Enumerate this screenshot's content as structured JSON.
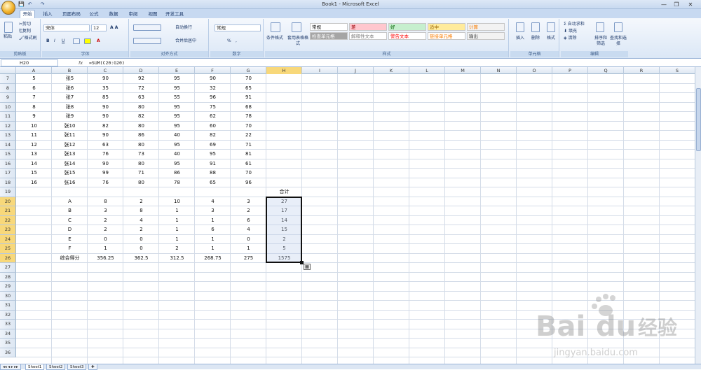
{
  "app": {
    "title": "Book1 - Microsoft Excel"
  },
  "qat": {
    "save": "💾",
    "undo": "↶",
    "redo": "↷"
  },
  "tabs": [
    "开始",
    "插入",
    "页面布局",
    "公式",
    "数据",
    "审阅",
    "视图",
    "开发工具"
  ],
  "ribbon": {
    "clipboard": {
      "label": "剪贴板",
      "paste": "粘贴",
      "cut": "剪切",
      "copy": "复制",
      "format_painter": "格式刷"
    },
    "font": {
      "label": "字体",
      "name": "宋体",
      "size": "12",
      "bold": "B",
      "italic": "I",
      "underline": "U"
    },
    "alignment": {
      "label": "对齐方式",
      "wrap": "自动换行",
      "merge": "合并后居中"
    },
    "number": {
      "label": "数字",
      "format": "常规",
      "percent": "%",
      "comma": ","
    },
    "styles": {
      "label": "样式",
      "conditional": "条件格式",
      "table": "套用表格格式",
      "cells": [
        {
          "text": "常规",
          "bg": "#ffffff",
          "fg": "#000000"
        },
        {
          "text": "差",
          "bg": "#ffc7ce",
          "fg": "#9c0006"
        },
        {
          "text": "好",
          "bg": "#c6efce",
          "fg": "#006100"
        },
        {
          "text": "适中",
          "bg": "#ffeb9c",
          "fg": "#9c6500"
        },
        {
          "text": "计算",
          "bg": "#f2f2f2",
          "fg": "#fa7d00"
        },
        {
          "text": "检查单元格",
          "bg": "#a5a5a5",
          "fg": "#ffffff"
        },
        {
          "text": "解释性文本",
          "bg": "#ffffff",
          "fg": "#7f7f7f"
        },
        {
          "text": "警告文本",
          "bg": "#ffffff",
          "fg": "#ff0000"
        },
        {
          "text": "链接单元格",
          "bg": "#ffffff",
          "fg": "#fa7d00"
        },
        {
          "text": "输出",
          "bg": "#f2f2f2",
          "fg": "#3f3f3f"
        }
      ]
    },
    "cells_group": {
      "label": "单元格",
      "insert": "插入",
      "delete": "删除",
      "format": "格式"
    },
    "editing": {
      "label": "编辑",
      "autosum": "自动求和",
      "fill": "填充",
      "clear": "清除",
      "sort": "排序和筛选",
      "find": "查找和选择"
    }
  },
  "formula_bar": {
    "name_box": "H20",
    "fx": "fx",
    "formula": "=SUM(C20:G20)"
  },
  "columns": [
    "A",
    "B",
    "C",
    "D",
    "E",
    "F",
    "G",
    "H",
    "I",
    "J",
    "K",
    "L",
    "M",
    "N",
    "O",
    "P",
    "Q",
    "R",
    "S"
  ],
  "selected_column": "H",
  "first_row": 7,
  "last_row": 36,
  "selected_rows": [
    20,
    21,
    22,
    23,
    24,
    25,
    26
  ],
  "rows": [
    {
      "r": 7,
      "cells": [
        "5",
        "张5",
        "90",
        "92",
        "95",
        "90",
        "70",
        ""
      ]
    },
    {
      "r": 8,
      "cells": [
        "6",
        "张6",
        "35",
        "72",
        "95",
        "32",
        "65",
        ""
      ]
    },
    {
      "r": 9,
      "cells": [
        "7",
        "张7",
        "85",
        "63",
        "55",
        "96",
        "91",
        ""
      ]
    },
    {
      "r": 10,
      "cells": [
        "8",
        "张8",
        "90",
        "80",
        "95",
        "75",
        "68",
        ""
      ]
    },
    {
      "r": 11,
      "cells": [
        "9",
        "张9",
        "90",
        "82",
        "95",
        "62",
        "78",
        ""
      ]
    },
    {
      "r": 12,
      "cells": [
        "10",
        "张10",
        "82",
        "80",
        "95",
        "60",
        "70",
        ""
      ]
    },
    {
      "r": 13,
      "cells": [
        "11",
        "张11",
        "90",
        "86",
        "40",
        "82",
        "22",
        ""
      ]
    },
    {
      "r": 14,
      "cells": [
        "12",
        "张12",
        "63",
        "80",
        "95",
        "69",
        "71",
        ""
      ]
    },
    {
      "r": 15,
      "cells": [
        "13",
        "张13",
        "76",
        "73",
        "40",
        "95",
        "81",
        ""
      ]
    },
    {
      "r": 16,
      "cells": [
        "14",
        "张14",
        "90",
        "80",
        "95",
        "91",
        "61",
        ""
      ]
    },
    {
      "r": 17,
      "cells": [
        "15",
        "张15",
        "99",
        "71",
        "86",
        "88",
        "70",
        ""
      ]
    },
    {
      "r": 18,
      "cells": [
        "16",
        "张16",
        "76",
        "80",
        "78",
        "65",
        "96",
        ""
      ]
    },
    {
      "r": 19,
      "cells": [
        "",
        "",
        "",
        "",
        "",
        "",
        "",
        "合计"
      ]
    },
    {
      "r": 20,
      "cells": [
        "",
        "A",
        "8",
        "2",
        "10",
        "4",
        "3",
        "27"
      ]
    },
    {
      "r": 21,
      "cells": [
        "",
        "B",
        "3",
        "8",
        "1",
        "3",
        "2",
        "17"
      ]
    },
    {
      "r": 22,
      "cells": [
        "",
        "C",
        "2",
        "4",
        "1",
        "1",
        "6",
        "14"
      ]
    },
    {
      "r": 23,
      "cells": [
        "",
        "D",
        "2",
        "2",
        "1",
        "6",
        "4",
        "15"
      ]
    },
    {
      "r": 24,
      "cells": [
        "",
        "E",
        "0",
        "0",
        "1",
        "1",
        "0",
        "2"
      ]
    },
    {
      "r": 25,
      "cells": [
        "",
        "F",
        "1",
        "0",
        "2",
        "1",
        "1",
        "5"
      ]
    },
    {
      "r": 26,
      "cells": [
        "",
        "综合得分",
        "356.25",
        "362.5",
        "312.5",
        "268.75",
        "275",
        "1575"
      ]
    }
  ],
  "sheets": [
    "Sheet1",
    "Sheet2",
    "Sheet3"
  ],
  "active_sheet": "Sheet1",
  "watermark": {
    "brand": "Bai",
    "brand2": "du",
    "cn": "经验",
    "url": "jingyan.baidu.com"
  }
}
